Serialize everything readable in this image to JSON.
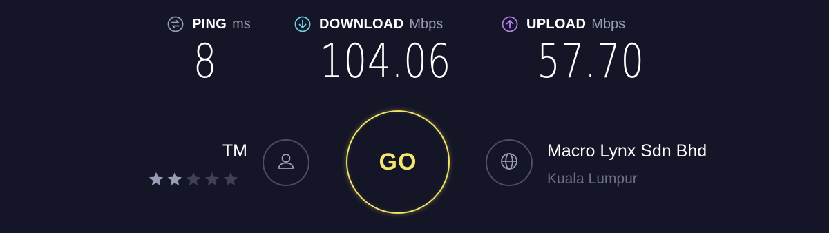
{
  "metrics": {
    "ping": {
      "label": "PING",
      "unit": "ms",
      "value": "8",
      "icon": "ping-icon",
      "color": "#9a9bb5"
    },
    "download": {
      "label": "DOWNLOAD",
      "unit": "Mbps",
      "value": "104.06",
      "icon": "download-arrow-icon",
      "color": "#6fd3e6"
    },
    "upload": {
      "label": "UPLOAD",
      "unit": "Mbps",
      "value": "57.70",
      "icon": "upload-arrow-icon",
      "color": "#b57fe8"
    }
  },
  "isp": {
    "name": "TM",
    "rating": 2,
    "max_rating": 5,
    "icon": "user-icon"
  },
  "go_button": {
    "label": "GO",
    "color": "#f4e66e"
  },
  "server": {
    "name": "Macro Lynx Sdn Bhd",
    "location": "Kuala Lumpur",
    "icon": "globe-icon"
  },
  "colors": {
    "background": "#141526",
    "star_filled": "#9a9bb5",
    "star_empty": "#3f4056",
    "circle_border": "#4d4e66"
  }
}
